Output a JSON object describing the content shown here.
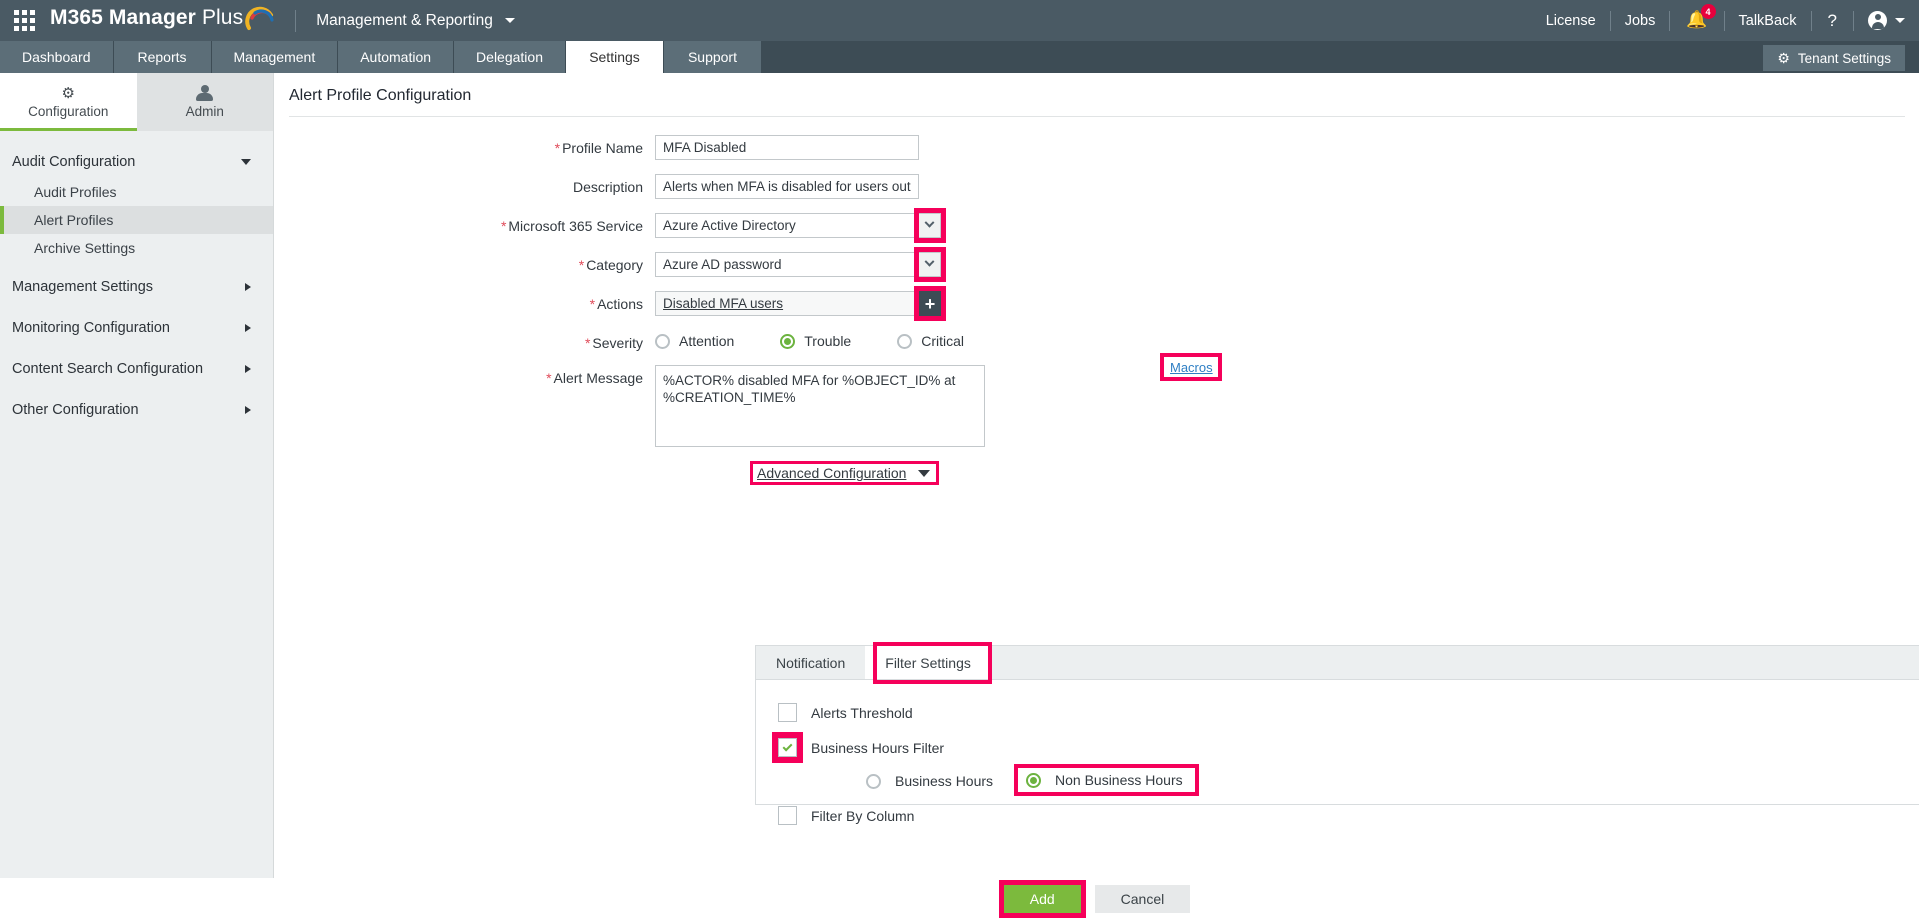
{
  "header": {
    "waffle_icon": "app-grid-icon",
    "brand_bold": "M365 Manager",
    "brand_light": "Plus",
    "module_label": "Management & Reporting",
    "links": [
      {
        "label": "License",
        "name": "license-link"
      },
      {
        "label": "Jobs",
        "name": "jobs-link"
      }
    ],
    "notification_icon": "bell-icon",
    "notification_count": "4",
    "talkback_label": "TalkBack",
    "help_label": "?",
    "account_icon": "user-avatar-icon"
  },
  "nav": {
    "tabs": [
      {
        "label": "Dashboard",
        "active": false
      },
      {
        "label": "Reports",
        "active": false
      },
      {
        "label": "Management",
        "active": false
      },
      {
        "label": "Automation",
        "active": false
      },
      {
        "label": "Delegation",
        "active": false
      },
      {
        "label": "Settings",
        "active": true
      },
      {
        "label": "Support",
        "active": false
      }
    ],
    "tenant_settings_label": "Tenant Settings",
    "tenant_settings_icon": "gear-icon"
  },
  "sidebar": {
    "tabs": [
      {
        "label": "Configuration",
        "icon": "gear-icon",
        "active": true
      },
      {
        "label": "Admin",
        "icon": "person-icon",
        "active": false
      }
    ],
    "groups": [
      {
        "label": "Audit Configuration",
        "expanded": true,
        "children": [
          {
            "label": "Audit Profiles",
            "active": false
          },
          {
            "label": "Alert Profiles",
            "active": true
          },
          {
            "label": "Archive Settings",
            "active": false
          }
        ]
      },
      {
        "label": "Management Settings",
        "expanded": false,
        "children": []
      },
      {
        "label": "Monitoring Configuration",
        "expanded": false,
        "children": []
      },
      {
        "label": "Content Search Configuration",
        "expanded": false,
        "children": []
      },
      {
        "label": "Other Configuration",
        "expanded": false,
        "children": []
      }
    ]
  },
  "main": {
    "page_title": "Alert Profile Configuration",
    "fields": {
      "profile_name": {
        "label": "Profile Name",
        "required": true,
        "value": "MFA Disabled",
        "placeholder": ""
      },
      "description": {
        "label": "Description",
        "required": false,
        "value": "Alerts when MFA is disabled for users outsid",
        "placeholder": ""
      },
      "microsoft_365_service": {
        "label": "Microsoft 365 Service",
        "required": true,
        "value": "Azure Active Directory",
        "dropdown_icon": "chevron-down-icon",
        "highlighted": true
      },
      "category": {
        "label": "Category",
        "required": true,
        "value": "Azure AD password",
        "dropdown_icon": "chevron-down-icon",
        "highlighted": true
      },
      "actions": {
        "label": "Actions",
        "required": true,
        "value": "Disabled MFA users",
        "add_icon": "plus-icon",
        "highlighted": true
      },
      "severity": {
        "label": "Severity",
        "required": true,
        "options": [
          {
            "label": "Attention",
            "selected": false
          },
          {
            "label": "Trouble",
            "selected": true
          },
          {
            "label": "Critical",
            "selected": false
          }
        ]
      },
      "alert_message": {
        "label": "Alert Message",
        "required": true,
        "value": "%ACTOR% disabled MFA for %OBJECT_ID% at %CREATION_TIME%",
        "macros_link": "Macros",
        "highlighted": true
      }
    },
    "advanced_configuration": {
      "label": "Advanced Configuration",
      "caret_icon": "caret-down-icon",
      "highlighted": true
    },
    "panel": {
      "tabs": [
        {
          "label": "Notification",
          "active": false
        },
        {
          "label": "Filter Settings",
          "active": true,
          "highlighted": true
        }
      ],
      "filter_settings": {
        "alerts_threshold": {
          "label": "Alerts Threshold",
          "checked": false
        },
        "business_hours_filter": {
          "label": "Business Hours Filter",
          "checked": true,
          "highlighted": true,
          "options": [
            {
              "label": "Business Hours",
              "selected": false,
              "highlighted": false
            },
            {
              "label": "Non Business Hours",
              "selected": true,
              "highlighted": true
            }
          ]
        },
        "filter_by_column": {
          "label": "Filter By Column",
          "checked": false
        }
      }
    },
    "footer": {
      "add_label": "Add",
      "add_highlighted": true,
      "cancel_label": "Cancel"
    }
  },
  "colors": {
    "highlight": "#f5005a",
    "accent_green": "#7cba3d",
    "header_bg": "#4a5a64",
    "nav_bg": "#3d4c55",
    "link_blue": "#2e7fc4"
  }
}
